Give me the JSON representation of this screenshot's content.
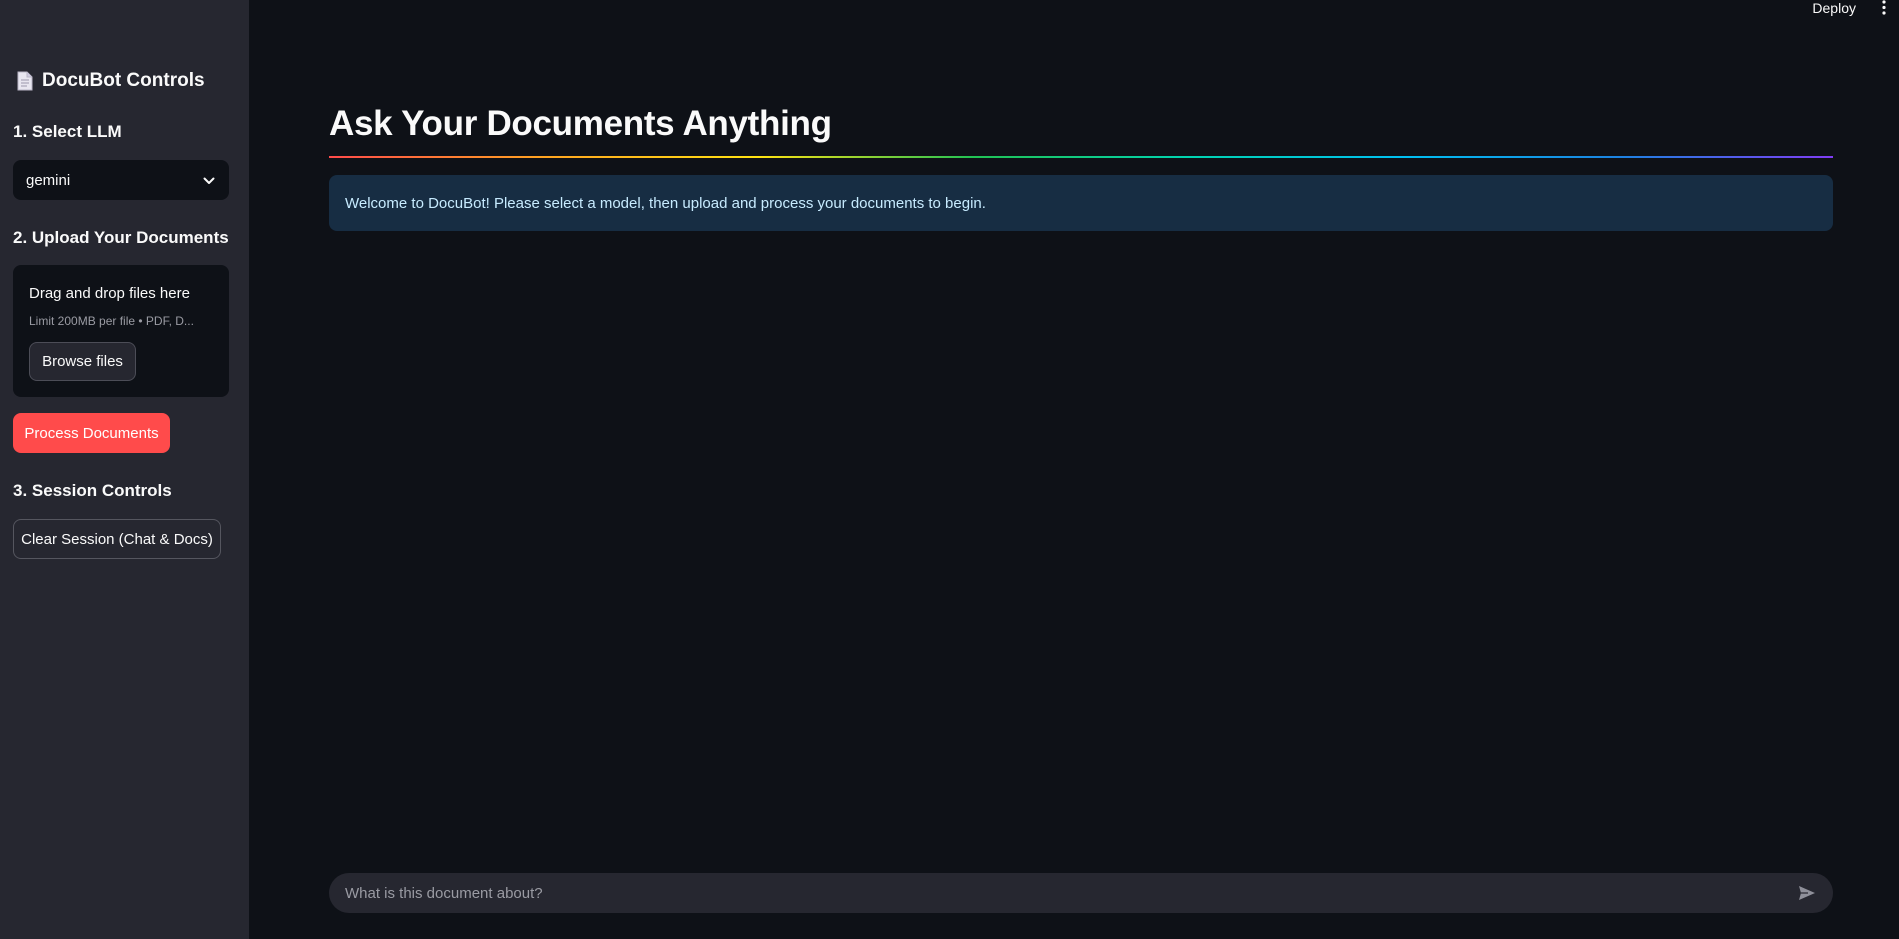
{
  "header": {
    "deploy_label": "Deploy"
  },
  "sidebar": {
    "title": "DocuBot Controls",
    "section1_heading": "1. Select LLM",
    "llm_select_value": "gemini",
    "section2_heading": "2. Upload Your Documents",
    "uploader": {
      "title": "Drag and drop files here",
      "limit_text": "Limit 200MB per file • PDF, D...",
      "browse_label": "Browse files"
    },
    "process_label": "Process Documents",
    "section3_heading": "3. Session Controls",
    "clear_label": "Clear Session (Chat & Docs)"
  },
  "main": {
    "title": "Ask Your Documents Anything",
    "info_message": "Welcome to DocuBot! Please select a model, then upload and process your documents to begin.",
    "chat_placeholder": "What is this document about?"
  },
  "colors": {
    "primary": "#ff4b4b",
    "background": "#0e1117",
    "sidebar": "#262730",
    "info_bg": "#172d43"
  },
  "icons": {
    "sidebar_title": "document-icon",
    "select": "chevron-down-icon",
    "menu": "more-vertical-icon",
    "send": "send-icon"
  }
}
